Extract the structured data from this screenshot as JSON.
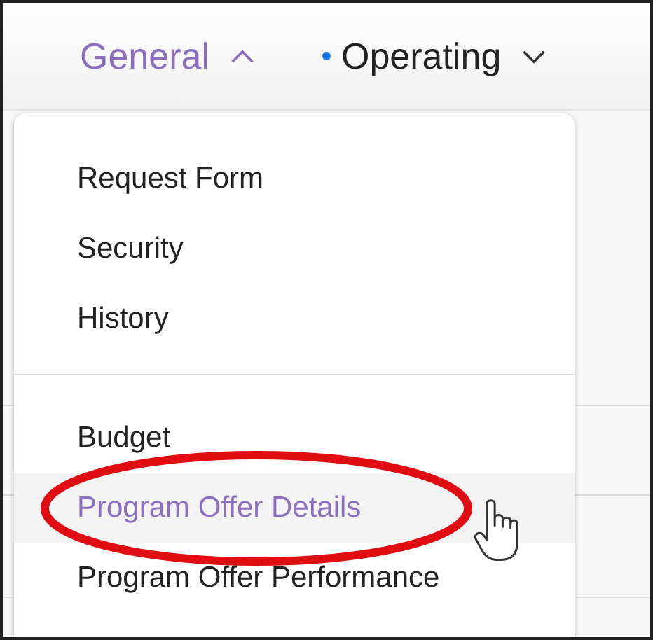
{
  "nav": [
    {
      "label": "General",
      "selected": true,
      "expanded": true,
      "dot": false
    },
    {
      "label": "Operating",
      "selected": false,
      "expanded": false,
      "dot": true
    }
  ],
  "menu": {
    "groups": [
      {
        "items": [
          {
            "label": "Request Form",
            "selected": false
          },
          {
            "label": "Security",
            "selected": false
          },
          {
            "label": "History",
            "selected": false
          }
        ]
      },
      {
        "items": [
          {
            "label": "Budget",
            "selected": false
          },
          {
            "label": "Program Offer Details",
            "selected": true
          },
          {
            "label": "Program Offer Performance",
            "selected": false
          }
        ]
      }
    ]
  }
}
